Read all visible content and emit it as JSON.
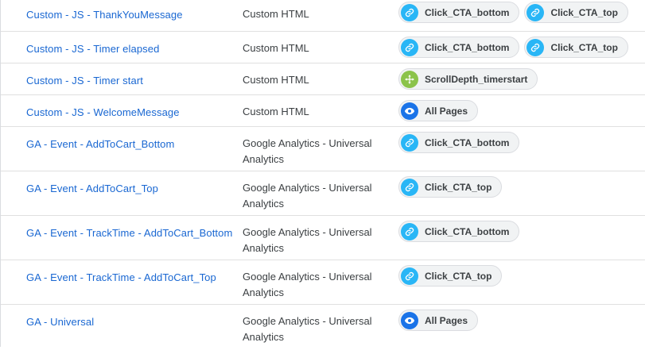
{
  "colors": {
    "link": "#1967d2",
    "click_icon_bg": "#29b6f6",
    "scroll_icon_bg": "#8bc34a",
    "pageview_icon_bg": "#1a73e8"
  },
  "rows": [
    {
      "name": "Custom - JS - ThankYouMessage",
      "type": "Custom HTML",
      "triggers": [
        {
          "label": "Click_CTA_bottom",
          "icon": "link-icon"
        },
        {
          "label": "Click_CTA_top",
          "icon": "link-icon"
        }
      ]
    },
    {
      "name": "Custom - JS - Timer elapsed",
      "type": "Custom HTML",
      "triggers": [
        {
          "label": "Click_CTA_bottom",
          "icon": "link-icon"
        },
        {
          "label": "Click_CTA_top",
          "icon": "link-icon"
        }
      ]
    },
    {
      "name": "Custom - JS - Timer start",
      "type": "Custom HTML",
      "triggers": [
        {
          "label": "ScrollDepth_timerstart",
          "icon": "scroll-depth-icon"
        }
      ]
    },
    {
      "name": "Custom - JS - WelcomeMessage",
      "type": "Custom HTML",
      "triggers": [
        {
          "label": "All Pages",
          "icon": "eye-icon"
        }
      ]
    },
    {
      "name": "GA - Event - AddToCart_Bottom",
      "type": "Google Analytics - Universal Analytics",
      "triggers": [
        {
          "label": "Click_CTA_bottom",
          "icon": "link-icon"
        }
      ]
    },
    {
      "name": "GA - Event - AddToCart_Top",
      "type": "Google Analytics - Universal Analytics",
      "triggers": [
        {
          "label": "Click_CTA_top",
          "icon": "link-icon"
        }
      ]
    },
    {
      "name": "GA - Event - TrackTime - AddToCart_Bottom",
      "type": "Google Analytics - Universal Analytics",
      "triggers": [
        {
          "label": "Click_CTA_bottom",
          "icon": "link-icon"
        }
      ]
    },
    {
      "name": "GA - Event - TrackTime - AddToCart_Top",
      "type": "Google Analytics - Universal Analytics",
      "triggers": [
        {
          "label": "Click_CTA_top",
          "icon": "link-icon"
        }
      ]
    },
    {
      "name": "GA - Universal",
      "type": "Google Analytics - Universal Analytics",
      "triggers": [
        {
          "label": "All Pages",
          "icon": "eye-icon"
        }
      ]
    }
  ]
}
